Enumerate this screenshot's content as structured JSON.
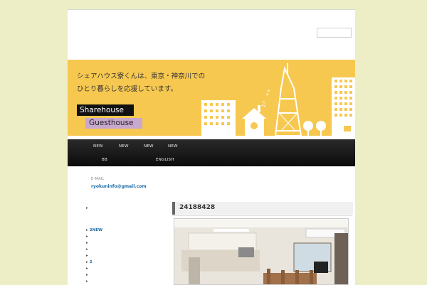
{
  "banner": {
    "tagline_line1": "シェアハウス寮くんは、東京・神奈川での",
    "tagline_line2": "ひとり暮らしを応援しています。",
    "label_sharehouse": "Sharehouse",
    "label_guesthouse": "Guesthouse"
  },
  "nav": {
    "row1": [
      "NEW",
      "NEW",
      "NEW",
      "NEW"
    ],
    "row2": [
      "BB",
      "ENGLISH"
    ]
  },
  "contact": {
    "label": "E-MAIL",
    "email": "ryokuninfo@gmail.com"
  },
  "sidebar": {
    "items": [
      "",
      "2NEW",
      "",
      "",
      "",
      "",
      "2",
      "",
      "",
      ""
    ]
  },
  "post": {
    "title": "24188428"
  },
  "colors": {
    "background": "#eeeec6",
    "banner": "#f7c850",
    "nav": "#111111",
    "link": "#1b6aa5",
    "guesthouse_label": "#c8a8cf"
  }
}
